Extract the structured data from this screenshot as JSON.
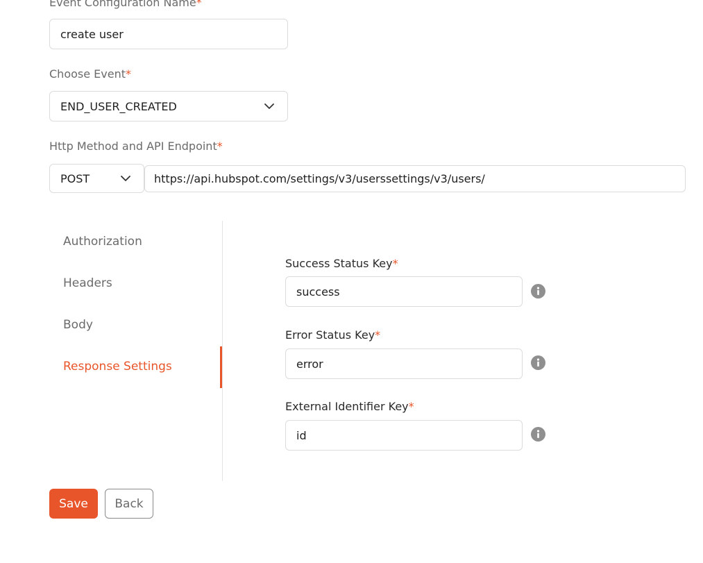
{
  "form": {
    "config_name": {
      "label": "Event Configuration Name",
      "required_mark": "*",
      "value": "create user"
    },
    "event": {
      "label": "Choose Event",
      "required_mark": "*",
      "value": "END_USER_CREATED"
    },
    "http": {
      "label": "Http Method and API Endpoint",
      "required_mark": "*",
      "method": "POST",
      "endpoint": "https://api.hubspot.com/settings/v3/userssettings/v3/users/"
    }
  },
  "tabs": [
    {
      "label": "Authorization",
      "active": false
    },
    {
      "label": "Headers",
      "active": false
    },
    {
      "label": "Body",
      "active": false
    },
    {
      "label": "Response Settings",
      "active": true
    }
  ],
  "response_settings": [
    {
      "label": "Success Status Key",
      "required_mark": "*",
      "value": "success",
      "icon": "info-icon"
    },
    {
      "label": "Error Status Key",
      "required_mark": "*",
      "value": "error",
      "icon": "info-icon"
    },
    {
      "label": "External Identifier Key",
      "required_mark": "*",
      "value": "id",
      "icon": "info-icon"
    }
  ],
  "actions": {
    "save_label": "Save",
    "back_label": "Back"
  },
  "colors": {
    "accent": "#e8552a",
    "muted_text": "#6b6b6b",
    "border": "#dcdcdc",
    "info_icon": "#8f8f8f"
  }
}
